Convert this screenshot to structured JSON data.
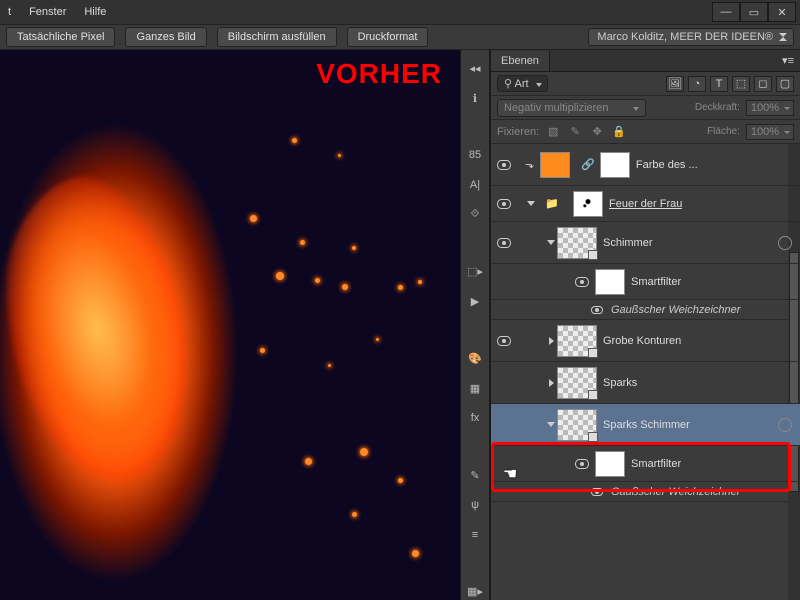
{
  "menu": {
    "t": "t",
    "fenster": "Fenster",
    "hilfe": "Hilfe"
  },
  "window_controls": {
    "min": "—",
    "max": "▭",
    "close": "✕"
  },
  "options_bar": {
    "actual_pixels": "Tatsächliche Pixel",
    "fit_screen": "Ganzes Bild",
    "fill_screen": "Bildschirm ausfüllen",
    "print_size": "Druckformat",
    "workspace": "Marco Kolditz, MEER DER IDEEN®"
  },
  "canvas": {
    "overlay_label": "VORHER"
  },
  "layers_panel": {
    "title": "Ebenen",
    "search_kind": "Art",
    "blend_mode": "Negativ multiplizieren",
    "opacity_label": "Deckkraft:",
    "opacity_value": "100%",
    "lock_label": "Fixieren:",
    "fill_label": "Fläche:",
    "fill_value": "100%"
  },
  "layers": [
    {
      "name": "Farbe des ...",
      "type": "fill"
    },
    {
      "name": "Feuer der Frau",
      "type": "group"
    },
    {
      "name": "Schimmer",
      "type": "smart"
    },
    {
      "name": "Smartfilter",
      "type": "mask"
    },
    {
      "name": "Gaußscher Weichzeichner",
      "type": "filter"
    },
    {
      "name": "Grobe Konturen",
      "type": "smart"
    },
    {
      "name": "Sparks",
      "type": "smart"
    },
    {
      "name": "Sparks Schimmer",
      "type": "smart"
    },
    {
      "name": "Smartfilter",
      "type": "mask"
    },
    {
      "name": "Gaußscher Weichzeichner",
      "type": "filter"
    }
  ],
  "collapse_icons": [
    "ℹ",
    "85",
    "A|",
    "⟐",
    "⬚▸",
    "▶",
    "🎨",
    "▦",
    "fx",
    "✎",
    "ψ",
    "≡",
    "▦▸"
  ],
  "filter_icons": [
    "🖼",
    "◔",
    "T",
    "⬚",
    "◻",
    "⬚"
  ]
}
